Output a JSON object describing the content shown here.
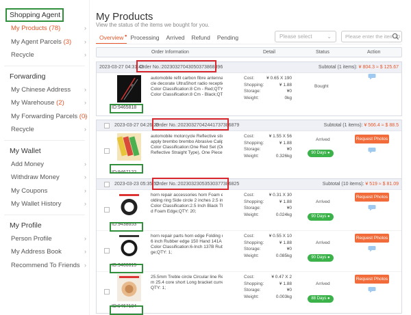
{
  "sidebar": {
    "agent_title": "Shopping Agent",
    "agent_items": [
      {
        "label": "My Products",
        "count": "(78)"
      },
      {
        "label": "My Agent Parcels",
        "count": "(3)"
      },
      {
        "label": "Recycle",
        "count": ""
      }
    ],
    "forwarding_title": "Forwarding",
    "forwarding_items": [
      {
        "label": "My Chinese Address",
        "count": ""
      },
      {
        "label": "My Warehouse",
        "count": "(2)"
      },
      {
        "label": "My Forwarding Parcels",
        "count": "(0)"
      },
      {
        "label": "Recycle",
        "count": ""
      }
    ],
    "wallet_title": "My Wallet",
    "wallet_items": [
      {
        "label": "Add Money"
      },
      {
        "label": "Withdraw Money"
      },
      {
        "label": "My Coupons"
      },
      {
        "label": "My Wallet History"
      }
    ],
    "profile_title": "My Profile",
    "profile_items": [
      {
        "label": "Person Profile"
      },
      {
        "label": "My Address Book"
      },
      {
        "label": "Recommend To Friends"
      }
    ]
  },
  "main": {
    "title": "My Products",
    "subtitle": "View the status of the items we bought for you.",
    "tabs": [
      {
        "label": "Overview",
        "active": true
      },
      {
        "label": "Processing"
      },
      {
        "label": "Arrived"
      },
      {
        "label": "Refund"
      },
      {
        "label": "Pending"
      }
    ],
    "select_placeholder": "Please select",
    "search_placeholder": "Please enter the item ID",
    "table_head": {
      "info": "Order Information",
      "detail": "Detail",
      "status": "Status",
      "action": "Action"
    }
  },
  "orders": [
    {
      "date": "2023-03-27 04:31:43",
      "order_no": "Order No.:20230327043050373868896",
      "subtotal_label": "Subtotal (1 items):",
      "subtotal": "¥ 804.3 ≈ $ 125.67",
      "items": [
        {
          "id": "ID:9465818",
          "desc": [
            "automobile refit carbon fibre antenna Vehi",
            "cle decorate UltraShort radio reception c...",
            "Color Classification:8 Cm - Red;QTY: 20;----",
            "Color Classification:8 Cm - Black;QTY: 50;-..."
          ],
          "cost": "¥ 0.65 X 190",
          "shopping": "¥ 1.88",
          "storage": "¥0",
          "weight": "0kg",
          "status": "Bought",
          "days": "",
          "action": ""
        }
      ]
    },
    {
      "date": "2023-03-27 04:26:28",
      "order_no": "Order No.:20230327042441737386879",
      "subtotal_label": "Subtotal (1 items):",
      "subtotal": "¥ 566.4 ≈ $ 88.5",
      "items": [
        {
          "id": "ID:9467122",
          "desc": [
            "automobile motorcycle Reflective stickers",
            "apply brembo brembo Abrasive Calipers ...",
            "Color Classification:One Red Set (Ordinary",
            "Reflective Straight Type), One Piece With ..."
          ],
          "cost": "¥ 1.55 X 56",
          "shopping": "¥ 1.88",
          "storage": "¥0",
          "weight": "0.326kg",
          "status": "Arrived",
          "days": "90 Days",
          "action": "Request Photos"
        }
      ]
    },
    {
      "date": "2023-03-23 05:35:57",
      "order_no": "Order No.:20230323053530377386825",
      "subtotal_label": "Subtotal (10 items):",
      "subtotal": "¥ 519 ≈ $ 81.09",
      "items": [
        {
          "id": "ID:9438653",
          "desc": [
            "horn repair accessories horn Foam edge F",
            "olding ring Side circle 2 inches 2.5 inch 3 i...",
            "Color Classification:2.5 Inch Black Thickene",
            "d Foam Edge;QTY: 20;"
          ],
          "cost": "¥ 0.31 X 30",
          "shopping": "¥ 1.88",
          "storage": "¥0",
          "weight": "0.024kg",
          "status": "Arrived",
          "days": "90 Days",
          "action": "Request Photos"
        },
        {
          "id": "ID:9466615",
          "desc": [
            "horn repair parts horn edge Folding ring /",
            "6 inch Rubber edge 150 Hand 141A narrow...",
            "Color Classification:6-Inch 137B Rubber Ed",
            "ge;QTY: 1;"
          ],
          "cost": "¥ 0.55 X 10",
          "shopping": "¥ 1.88",
          "storage": "¥0",
          "weight": "0.085kg",
          "status": "Arrived",
          "days": "90 Days",
          "action": "Request Photos"
        },
        {
          "id": "ID:9467184",
          "desc": [
            "25.5mm Treble circle Circular line Resin fil",
            "m 25.4 core short Long bracket currency ...",
            "QTY: 1;",
            ""
          ],
          "cost": "¥ 0.47 X 2",
          "shopping": "¥ 1.88",
          "storage": "¥0",
          "weight": "0.003kg",
          "status": "Arrived",
          "days": "88 Days",
          "action": "Request Photos"
        }
      ]
    }
  ],
  "labels": {
    "cost": "Cost:",
    "shopping": "Shopping:",
    "storage": "Storage:",
    "weight": "Weight:"
  },
  "colors": {
    "accent": "#e8562a",
    "green": "#3bb34a",
    "highlight_green": "#2f8f3a",
    "highlight_red": "#d9262c"
  }
}
